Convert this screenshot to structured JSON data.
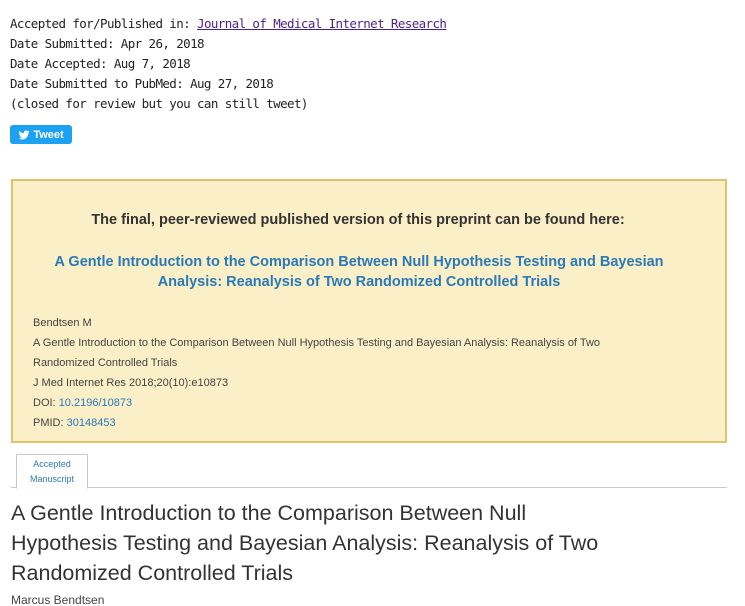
{
  "meta": {
    "published_in_label": "Accepted for/Published in:",
    "journal_name": "Journal of Medical Internet Research",
    "date_submitted": "Date Submitted: Apr 26, 2018",
    "date_accepted": "Date Accepted: Aug 7, 2018",
    "date_pubmed": "Date Submitted to PubMed: Aug 27, 2018",
    "review_note": "(closed for review but you can still tweet)"
  },
  "tweet": {
    "label": "Tweet",
    "icon": "twitter-bird-icon",
    "color": "#1da1f2"
  },
  "notice": {
    "heading": "The final, peer-reviewed published version of this preprint can be found here:",
    "article_link_line1": "A Gentle Introduction to the Comparison Between Null Hypothesis Testing and Bayesian",
    "article_link_line2": "Analysis: Reanalysis of Two Randomized Controlled Trials",
    "citation_author": "Bendtsen M",
    "citation_title_line1": "A Gentle Introduction to the Comparison Between Null Hypothesis Testing and Bayesian Analysis: Reanalysis of Two",
    "citation_title_line2": "Randomized Controlled Trials",
    "citation_journal": "J Med Internet Res 2018;20(10):e10873",
    "doi_label": "DOI:",
    "doi_value": "10.2196/10873",
    "pmid_label": "PMID:",
    "pmid_value": "30148453",
    "background_color": "#fbefc7",
    "border_color": "#e2c16b"
  },
  "tabs": {
    "accepted_line1": "Accepted",
    "accepted_line2": "Manuscript"
  },
  "article": {
    "title_line1": "A Gentle Introduction to the Comparison Between Null",
    "title_line2": "Hypothesis Testing and Bayesian Analysis: Reanalysis of Two",
    "title_line3": "Randomized Controlled Trials",
    "author": "Marcus Bendtsen"
  }
}
